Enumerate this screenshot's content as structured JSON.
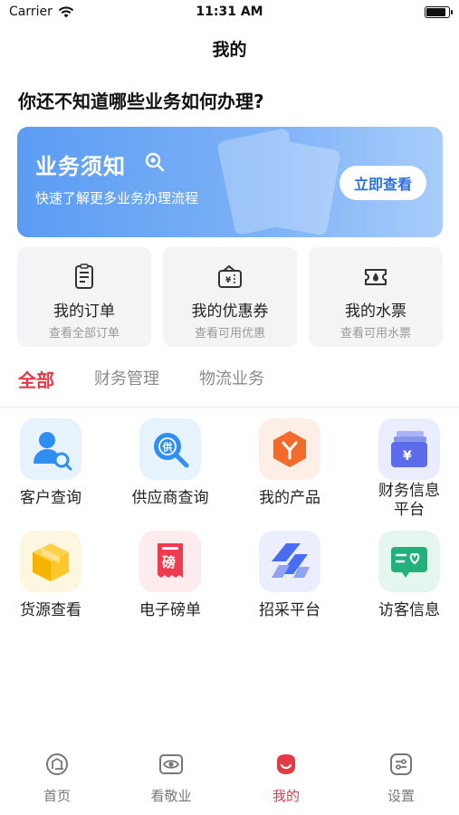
{
  "status_bar": {
    "carrier": "Carrier",
    "time": "11:31 AM",
    "battery_level": 0.9
  },
  "nav": {
    "title": "我的"
  },
  "question": "你还不知道哪些业务如何办理?",
  "banner": {
    "title": "业务须知",
    "subtitle": "快速了解更多业务办理流程",
    "button_label": "立即查看",
    "icon": "search-icon"
  },
  "quick_cards": [
    {
      "title": "我的订单",
      "subtitle": "查看全部订单",
      "icon": "order-icon"
    },
    {
      "title": "我的优惠券",
      "subtitle": "查看可用优惠",
      "icon": "coupon-icon"
    },
    {
      "title": "我的水票",
      "subtitle": "查看可用水票",
      "icon": "water-ticket-icon"
    }
  ],
  "tabs": [
    {
      "label": "全部",
      "active": true
    },
    {
      "label": "财务管理",
      "active": false
    },
    {
      "label": "物流业务",
      "active": false
    }
  ],
  "services": [
    {
      "label": "客户查询",
      "icon": "customer-search-icon",
      "bg": "#e6f3fd"
    },
    {
      "label": "供应商查询",
      "icon": "supplier-search-icon",
      "bg": "#e6f3fd"
    },
    {
      "label": "我的产品",
      "icon": "product-icon",
      "bg": "#fdeee6"
    },
    {
      "label": "财务信息平台",
      "icon": "finance-icon",
      "bg": "#eaedfd"
    },
    {
      "label": "货源查看",
      "icon": "cargo-box-icon",
      "bg": "#fdf6e0"
    },
    {
      "label": "电子磅单",
      "icon": "weigh-bill-icon",
      "bg": "#fdecee"
    },
    {
      "label": "招采平台",
      "icon": "procurement-icon",
      "bg": "#eaeefd"
    },
    {
      "label": "访客信息",
      "icon": "visitor-icon",
      "bg": "#e5f6ee"
    }
  ],
  "tabbar": [
    {
      "label": "首页",
      "icon": "home-icon",
      "active": false
    },
    {
      "label": "看敬业",
      "icon": "eye-icon",
      "active": false
    },
    {
      "label": "我的",
      "icon": "profile-icon",
      "active": true
    },
    {
      "label": "设置",
      "icon": "settings-icon",
      "active": false
    }
  ],
  "colors": {
    "accent": "#e63946",
    "banner_blue": "#5b9cf3",
    "button_text": "#2d6fe0"
  }
}
